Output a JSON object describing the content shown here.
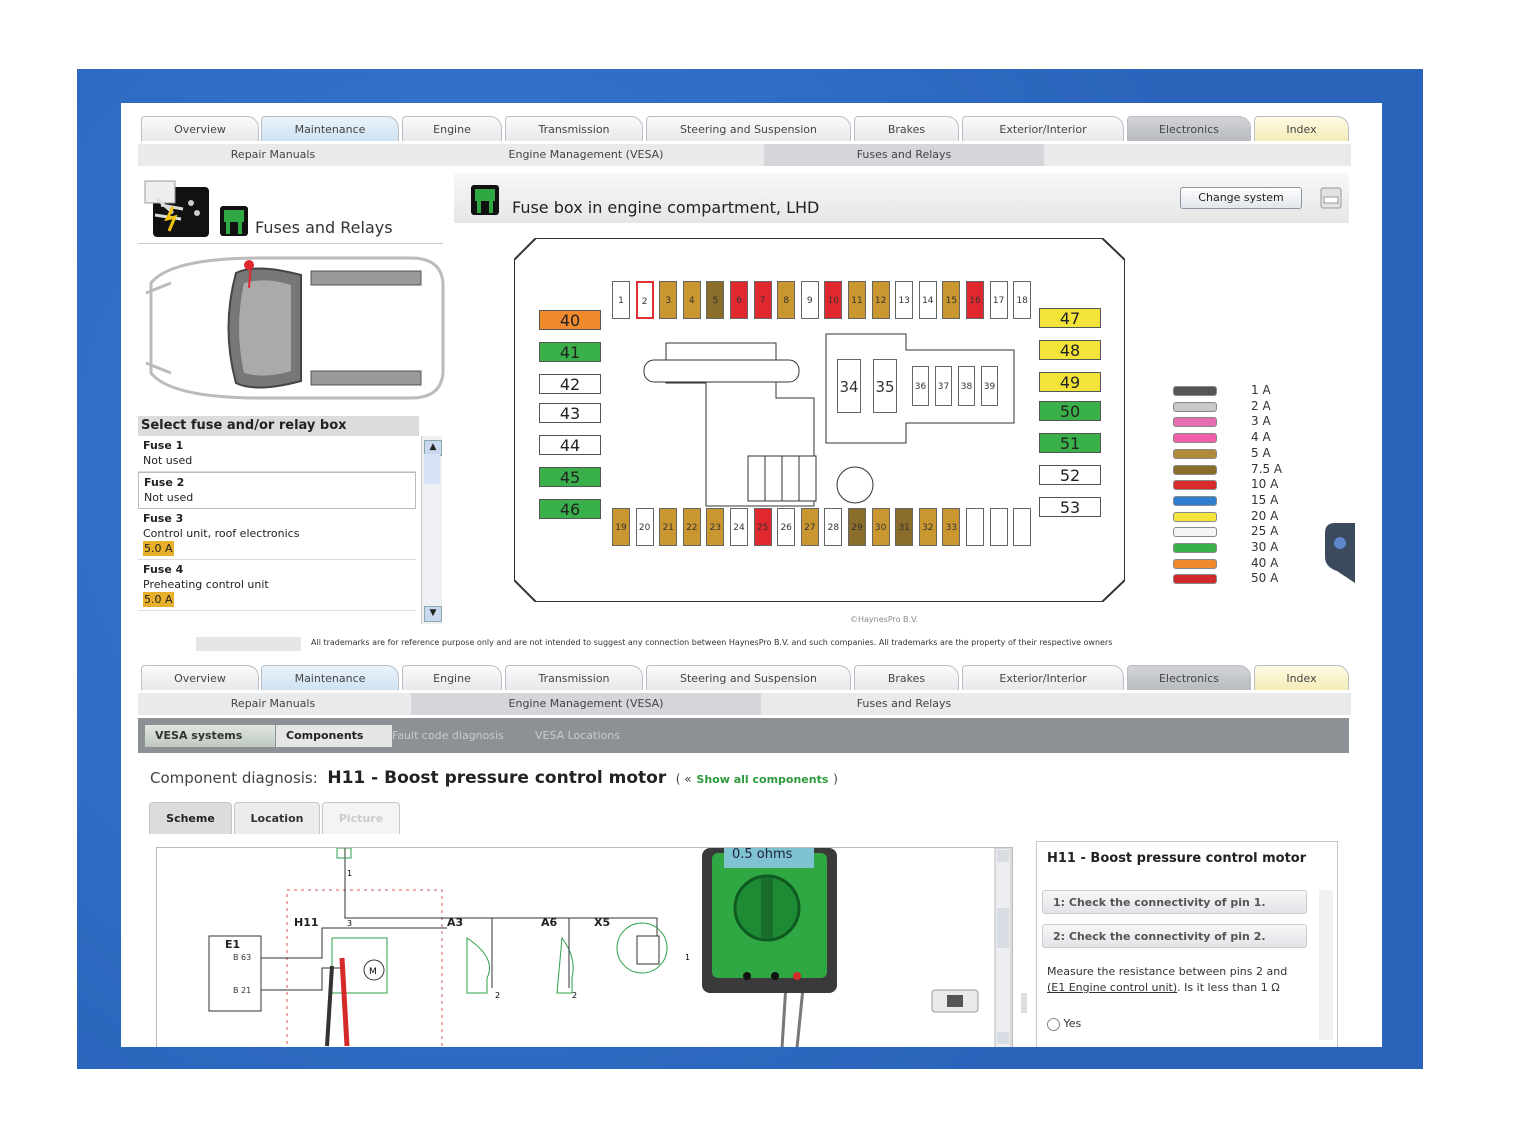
{
  "top_tabs": [
    "Overview",
    "Maintenance",
    "Engine",
    "Transmission",
    "Steering and Suspension",
    "Brakes",
    "Exterior/Interior",
    "Electronics",
    "Index"
  ],
  "top_subtabs": [
    "Repair Manuals",
    "Engine Management (VESA)",
    "Fuses and Relays"
  ],
  "left": {
    "title": "Fuses and Relays",
    "select_heading": "Select fuse and/or relay box",
    "fuses": [
      {
        "name": "Fuse 1",
        "desc": "Not used",
        "amp": ""
      },
      {
        "name": "Fuse 2",
        "desc": "Not used",
        "amp": ""
      },
      {
        "name": "Fuse 3",
        "desc": "Control unit, roof electronics",
        "amp": "5.0 A"
      },
      {
        "name": "Fuse 4",
        "desc": "Preheating control unit",
        "amp": "5.0 A"
      }
    ]
  },
  "fusebox": {
    "title": "Fuse box in engine compartment, LHD",
    "change_button": "Change system",
    "copyright": "©HaynesPro B.V.",
    "top_row": [
      "1",
      "2",
      "3",
      "4",
      "5",
      "6",
      "7",
      "8",
      "9",
      "10",
      "11",
      "12",
      "13",
      "14",
      "15",
      "16",
      "17",
      "18"
    ],
    "bottom_row": [
      "19",
      "20",
      "21",
      "22",
      "23",
      "24",
      "25",
      "26",
      "27",
      "28",
      "29",
      "30",
      "31",
      "32",
      "33",
      "",
      "",
      ""
    ],
    "left_big": [
      "40",
      "41",
      "42",
      "43",
      "44",
      "45",
      "46"
    ],
    "right_big": [
      "47",
      "48",
      "49",
      "50",
      "51",
      "52",
      "53"
    ],
    "relays_large": [
      "34",
      "35"
    ],
    "relays_small": [
      "36",
      "37",
      "38",
      "39"
    ]
  },
  "legend": [
    "1 A",
    "2 A",
    "3 A",
    "4 A",
    "5 A",
    "7.5 A",
    "10 A",
    "15 A",
    "20 A",
    "25 A",
    "30 A",
    "40 A",
    "50 A"
  ],
  "legend_colors": [
    "#555555",
    "#c8c8c8",
    "#e36fb0",
    "#f05fa8",
    "#b08a3a",
    "#8a6d2a",
    "#d92b2b",
    "#2f7fcf",
    "#f4e43a",
    "#f4f4f4",
    "#3ab04a",
    "#f08a2c",
    "#d02a2a"
  ],
  "notice": "All trademarks are for reference purpose only and are not intended to suggest any connection between HaynesPro B.V. and such companies. All trademarks are the property of their respective owners",
  "bottom_tabs": [
    "Overview",
    "Maintenance",
    "Engine",
    "Transmission",
    "Steering and Suspension",
    "Brakes",
    "Exterior/Interior",
    "Electronics",
    "Index"
  ],
  "bottom_subtabs": [
    "Repair Manuals",
    "Engine Management (VESA)",
    "Fuses and Relays"
  ],
  "vesa_tabs": [
    "VESA systems",
    "Components",
    "Fault code diagnosis",
    "VESA Locations"
  ],
  "component": {
    "label": "Component diagnosis:",
    "name": "H11 - Boost pressure control motor",
    "open": "( «",
    "link": "Show all components",
    "close": ")"
  },
  "scheme_tabs": [
    "Scheme",
    "Location",
    "Picture"
  ],
  "scheme": {
    "labels": [
      "E1",
      "B 63",
      "B 21",
      "H11",
      "A3",
      "A6",
      "X5",
      "1",
      "2",
      "3",
      "1",
      "2",
      "2",
      "2",
      "1",
      "2"
    ],
    "meter_reading": "0.5 ohms"
  },
  "right_panel": {
    "title": "H11 - Boost pressure control motor",
    "steps": [
      "1: Check the connectivity of pin 1.",
      "2: Check the connectivity of pin 2."
    ],
    "text": "Measure the resistance between pins 2 and",
    "link": "(E1 Engine control unit)",
    "text2": ". Is it less than 1 Ω",
    "yes": "Yes"
  }
}
